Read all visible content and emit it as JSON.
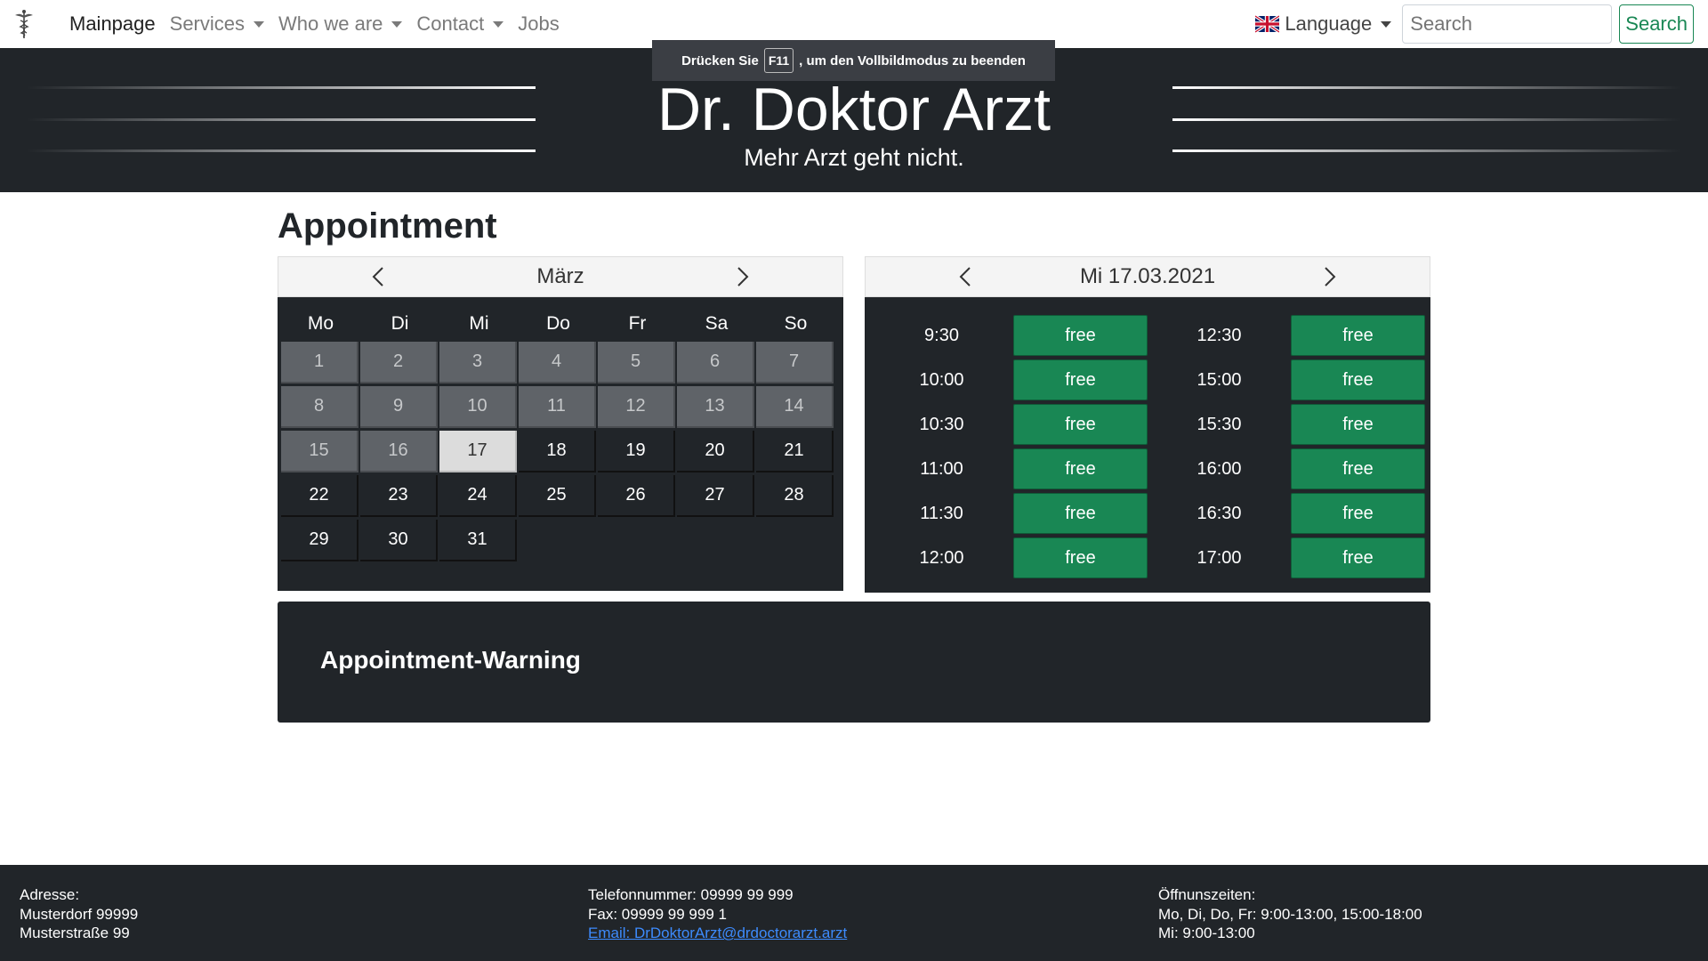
{
  "nav": {
    "brand_icon": "caduceus-icon",
    "items": [
      {
        "label": "Mainpage",
        "active": true,
        "dropdown": false
      },
      {
        "label": "Services",
        "active": false,
        "dropdown": true
      },
      {
        "label": "Who we are",
        "active": false,
        "dropdown": true
      },
      {
        "label": "Contact",
        "active": false,
        "dropdown": true
      },
      {
        "label": "Jobs",
        "active": false,
        "dropdown": false
      }
    ],
    "language_label": "Language",
    "search_placeholder": "Search",
    "search_button": "Search"
  },
  "fullscreen_notice": {
    "before": "Drücken Sie",
    "key": "F11",
    "after": ", um den Vollbildmodus zu beenden"
  },
  "hero": {
    "title": "Dr. Doktor Arzt",
    "subtitle": "Mehr Arzt geht nicht."
  },
  "appointment": {
    "title": "Appointment",
    "calendar": {
      "month": "März",
      "weekdays": [
        "Mo",
        "Di",
        "Mi",
        "Do",
        "Fr",
        "Sa",
        "So"
      ],
      "days": [
        "1",
        "2",
        "3",
        "4",
        "5",
        "6",
        "7",
        "8",
        "9",
        "10",
        "11",
        "12",
        "13",
        "14",
        "15",
        "16",
        "17",
        "18",
        "19",
        "20",
        "21",
        "22",
        "23",
        "24",
        "25",
        "26",
        "27",
        "28",
        "29",
        "30",
        "31"
      ],
      "past_until": 16,
      "selected": "17"
    },
    "slots": {
      "date": "Mi 17.03.2021",
      "left": [
        {
          "time": "9:30",
          "status": "free"
        },
        {
          "time": "10:00",
          "status": "free"
        },
        {
          "time": "10:30",
          "status": "free"
        },
        {
          "time": "11:00",
          "status": "free"
        },
        {
          "time": "11:30",
          "status": "free"
        },
        {
          "time": "12:00",
          "status": "free"
        }
      ],
      "right": [
        {
          "time": "12:30",
          "status": "free"
        },
        {
          "time": "15:00",
          "status": "free"
        },
        {
          "time": "15:30",
          "status": "free"
        },
        {
          "time": "16:00",
          "status": "free"
        },
        {
          "time": "16:30",
          "status": "free"
        },
        {
          "time": "17:00",
          "status": "free"
        }
      ]
    },
    "warning_title": "Appointment-Warning"
  },
  "footer": {
    "address": [
      "Adresse:",
      "Musterdorf 99999",
      "Musterstraße 99"
    ],
    "phone": "Telefonnummer: 09999 99 999",
    "fax": "Fax: 09999 99 999 1",
    "email": "Email: DrDoktorArzt@drdoctorarzt.arzt",
    "hours": [
      "Öffnunszeiten:",
      "Mo, Di, Do, Fr: 9:00-13:00, 15:00-18:00",
      "Mi: 9:00-13:00"
    ]
  },
  "colors": {
    "dark": "#212529",
    "success": "#198754",
    "link": "#3d8bfd"
  }
}
